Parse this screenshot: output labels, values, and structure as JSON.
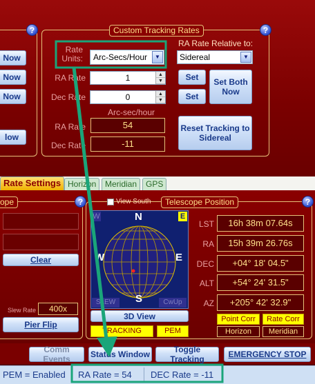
{
  "left_top": {
    "buttons": [
      "Now",
      "Now",
      "Now",
      "low"
    ]
  },
  "custom_tracking": {
    "title": "Custom Tracking Rates",
    "rate_units_label": "Rate\nUnits:",
    "rate_units_value": "Arc-Secs/Hour",
    "relative_label": "RA Rate Relative to:",
    "relative_value": "Sidereal",
    "ra_rate_label": "RA Rate",
    "ra_rate_value": "1",
    "dec_rate_label": "Dec Rate",
    "dec_rate_value": "0",
    "set_label": "Set",
    "set2_label": "Set",
    "set_both_label": "Set Both Now",
    "unit_caption": "Arc-sec/hour",
    "ra_rate_readout_label": "RA Rate",
    "ra_rate_readout": "54",
    "dec_rate_readout_label": "Dec Rate",
    "dec_rate_readout": "-11",
    "reset_label": "Reset Tracking to Sidereal"
  },
  "tabs": [
    {
      "label": "Rate Settings",
      "active": true
    },
    {
      "label": "Horizon"
    },
    {
      "label": "Meridian"
    },
    {
      "label": "GPS"
    }
  ],
  "left_bottom": {
    "title": "ope",
    "clear_label": "Clear",
    "slew_rate_label": "Slew Rate",
    "slew_rate_value": "400x",
    "pier_flip_label": "Pier Flip"
  },
  "telescope": {
    "view_south_label": "View South",
    "title": "Telescope Position",
    "compass": {
      "n": "N",
      "s": "S",
      "e": "E",
      "w": "W",
      "corner_e": "E",
      "corner_w": "W"
    },
    "slew_label": "SLEW",
    "cwup_label": "CwUp",
    "view3d_label": "3D View",
    "tracking_label": "TRACKING",
    "pem_label": "PEM",
    "rows": [
      {
        "label": "LST",
        "value": "16h 38m 07.64s"
      },
      {
        "label": "RA",
        "value": "15h 39m 26.76s"
      },
      {
        "label": "DEC",
        "value": "+04° 18' 04.5\""
      },
      {
        "label": "ALT",
        "value": "+54° 24' 31.5\""
      },
      {
        "label": "AZ",
        "value": "+205° 42' 32.9\""
      }
    ],
    "point_corr": "Point Corr",
    "rate_corr": "Rate Corr",
    "horizon": "Horizon",
    "meridian": "Meridian"
  },
  "bottom_bar": {
    "comm_events": "Comm Events",
    "status_window": "Status Window",
    "toggle_tracking": "Toggle Tracking",
    "emergency_stop": "EMERGENCY STOP"
  },
  "status_bar": {
    "pem": "PEM = Enabled",
    "ra_rate": "RA Rate = 54",
    "dec_rate": "DEC Rate = -11"
  },
  "annotation_color": "#1aa57a"
}
